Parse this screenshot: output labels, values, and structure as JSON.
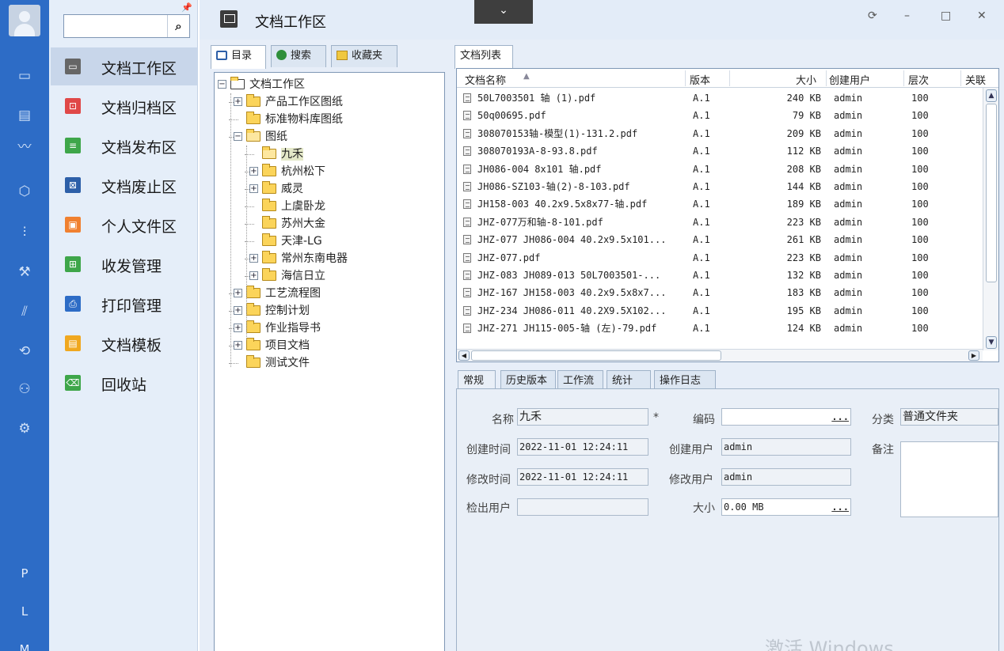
{
  "rail": {
    "icons": [
      "monitor-icon",
      "file-list-icon",
      "chart-line-icon",
      "cube-icon",
      "sliders-icon",
      "wrench-icon",
      "bar-chart-icon",
      "cycle-icon",
      "users-icon",
      "settings-icon"
    ],
    "letters": [
      "P",
      "L",
      "M"
    ]
  },
  "nav": {
    "search_placeholder": "",
    "items": [
      {
        "label": "文档工作区",
        "icon": "monitor-icon",
        "color": "#666666",
        "selected": true
      },
      {
        "label": "文档归档区",
        "icon": "archive-icon",
        "color": "#e04848",
        "selected": false
      },
      {
        "label": "文档发布区",
        "icon": "publish-icon",
        "color": "#3ea64a",
        "selected": false
      },
      {
        "label": "文档废止区",
        "icon": "abolish-icon",
        "color": "#2d5fa8",
        "selected": false
      },
      {
        "label": "个人文件区",
        "icon": "personal-icon",
        "color": "#f08030",
        "selected": false
      },
      {
        "label": "收发管理",
        "icon": "inbox-icon",
        "color": "#3ea64a",
        "selected": false
      },
      {
        "label": "打印管理",
        "icon": "printer-icon",
        "color": "#2d6cc6",
        "selected": false
      },
      {
        "label": "文档模板",
        "icon": "template-icon",
        "color": "#f0a820",
        "selected": false
      },
      {
        "label": "回收站",
        "icon": "trash-icon",
        "color": "#3ea64a",
        "selected": false
      }
    ]
  },
  "window": {
    "title": "文档工作区",
    "dropdown_glyph": "⌄",
    "controls": {
      "refresh": "⟳",
      "minimize": "–",
      "maximize": "□",
      "close": "✕"
    }
  },
  "left_tabs": [
    "目录",
    "搜索",
    "收藏夹"
  ],
  "tree": [
    {
      "label": "文档工作区",
      "level": 0,
      "expander": "-",
      "open": true
    },
    {
      "label": "产品工作区图纸",
      "level": 1,
      "expander": "+"
    },
    {
      "label": "标准物料库图纸",
      "level": 1,
      "expander": ""
    },
    {
      "label": "图纸",
      "level": 1,
      "expander": "-",
      "open": true
    },
    {
      "label": "九禾",
      "level": 2,
      "expander": "",
      "selected": true,
      "open": true
    },
    {
      "label": "杭州松下",
      "level": 2,
      "expander": "+"
    },
    {
      "label": "威灵",
      "level": 2,
      "expander": "+"
    },
    {
      "label": "上虞卧龙",
      "level": 2,
      "expander": ""
    },
    {
      "label": "苏州大金",
      "level": 2,
      "expander": ""
    },
    {
      "label": "天津-LG",
      "level": 2,
      "expander": ""
    },
    {
      "label": "常州东南电器",
      "level": 2,
      "expander": "+"
    },
    {
      "label": "海信日立",
      "level": 2,
      "expander": "+"
    },
    {
      "label": "工艺流程图",
      "level": 1,
      "expander": "+"
    },
    {
      "label": "控制计划",
      "level": 1,
      "expander": "+"
    },
    {
      "label": "作业指导书",
      "level": 1,
      "expander": "+"
    },
    {
      "label": "项目文档",
      "level": 1,
      "expander": "+"
    },
    {
      "label": "测试文件",
      "level": 1,
      "expander": ""
    }
  ],
  "list_tab": "文档列表",
  "columns": {
    "name": "文档名称",
    "version": "版本",
    "size": "大小",
    "creator": "创建用户",
    "level": "层次",
    "rel": "关联"
  },
  "rows": [
    {
      "name": "50L7003501 轴 (1).pdf",
      "version": "A.1",
      "size": "240 KB",
      "creator": "admin",
      "level": "100"
    },
    {
      "name": "50q00695.pdf",
      "version": "A.1",
      "size": "79 KB",
      "creator": "admin",
      "level": "100"
    },
    {
      "name": "308070153轴-模型(1)-131.2.pdf",
      "version": "A.1",
      "size": "209 KB",
      "creator": "admin",
      "level": "100"
    },
    {
      "name": "308070193A-8-93.8.pdf",
      "version": "A.1",
      "size": "112 KB",
      "creator": "admin",
      "level": "100"
    },
    {
      "name": "JH086-004 8x101 轴.pdf",
      "version": "A.1",
      "size": "208 KB",
      "creator": "admin",
      "level": "100"
    },
    {
      "name": "JH086-SZ103-轴(2)-8-103.pdf",
      "version": "A.1",
      "size": "144 KB",
      "creator": "admin",
      "level": "100"
    },
    {
      "name": "JH158-003 40.2x9.5x8x77-轴.pdf",
      "version": "A.1",
      "size": "189 KB",
      "creator": "admin",
      "level": "100"
    },
    {
      "name": "JHZ-077万和轴-8-101.pdf",
      "version": "A.1",
      "size": "223 KB",
      "creator": "admin",
      "level": "100"
    },
    {
      "name": "JHZ-077 JH086-004 40.2x9.5x101...",
      "version": "A.1",
      "size": "261 KB",
      "creator": "admin",
      "level": "100"
    },
    {
      "name": "JHZ-077.pdf",
      "version": "A.1",
      "size": "223 KB",
      "creator": "admin",
      "level": "100"
    },
    {
      "name": "JHZ-083 JH089-013 50L7003501-...",
      "version": "A.1",
      "size": "132 KB",
      "creator": "admin",
      "level": "100"
    },
    {
      "name": "JHZ-167 JH158-003 40.2x9.5x8x7...",
      "version": "A.1",
      "size": "183 KB",
      "creator": "admin",
      "level": "100"
    },
    {
      "name": "JHZ-234 JH086-011 40.2X9.5X102...",
      "version": "A.1",
      "size": "195 KB",
      "creator": "admin",
      "level": "100"
    },
    {
      "name": "JHZ-271 JH115-005-轴 (左)-79.pdf",
      "version": "A.1",
      "size": "124 KB",
      "creator": "admin",
      "level": "100"
    }
  ],
  "detail_tabs": [
    "常规",
    "历史版本",
    "工作流",
    "统计",
    "操作日志"
  ],
  "detail": {
    "name_label": "名称",
    "name_value": "九禾",
    "required_mark": "*",
    "code_label": "编码",
    "code_value": "",
    "category_label": "分类",
    "category_value": "普通文件夹",
    "created_label": "创建时间",
    "created_value": "2022-11-01 12:24:11",
    "creator_label": "创建用户",
    "creator_value": "admin",
    "remark_label": "备注",
    "modified_label": "修改时间",
    "modified_value": "2022-11-01 12:24:11",
    "modifier_label": "修改用户",
    "modifier_value": "admin",
    "checkout_label": "检出用户",
    "checkout_value": "",
    "size_label": "大小",
    "size_value": "0.00 MB",
    "ellipsis": "..."
  },
  "watermark": "激活 Windows"
}
